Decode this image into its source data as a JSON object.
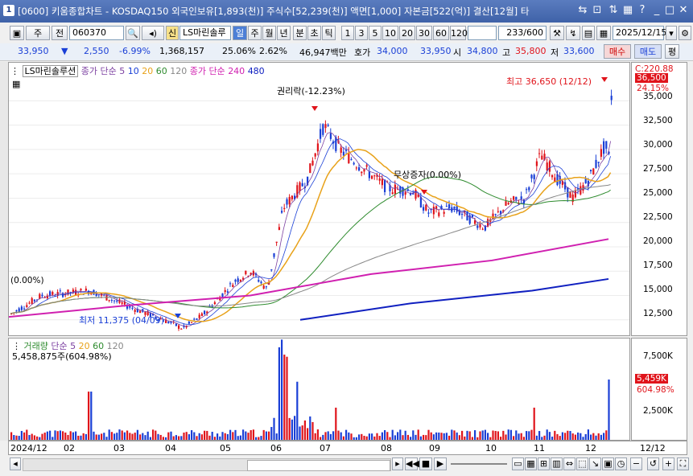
{
  "window": {
    "number": "1",
    "title": "[0600] 키움종합차트 - KOSDAQ150 외국인보유[1,893(천)] 주식수[52,239(천)] 액면[1,000] 자본금[522(억)] 결산[12월] 타"
  },
  "toolbar": {
    "menu1": "주",
    "menu2": "전",
    "code": "060370",
    "badge_new": "신",
    "stock_name": "LS마린솔루",
    "periods": [
      "일",
      "주",
      "월",
      "년",
      "분",
      "초",
      "틱"
    ],
    "active_period": "일",
    "ticks": [
      "1",
      "3",
      "5",
      "10",
      "20",
      "30",
      "60",
      "120"
    ],
    "count": "233",
    "count_total": "/600",
    "date": "2025/12/15"
  },
  "quote": {
    "price": "33,950",
    "change": "2,550",
    "change_pct": "-6.99%",
    "volume": "1,368,157",
    "turnover_pct": "25.06%",
    "ratio": "2.62%",
    "amount": "46,947백만",
    "bid_label": "호가",
    "bid": "34,000",
    "ask": "33,950",
    "open_label": "시",
    "open": "34,800",
    "high_label": "고",
    "high": "35,800",
    "low_label": "저",
    "low": "33,600",
    "buy": "매수",
    "sell": "매도",
    "eval": "평"
  },
  "legend": {
    "name": "LS마린솔루션",
    "ma_label": "종가 단순",
    "ma_vals": [
      "5",
      "10",
      "20",
      "60",
      "120"
    ],
    "ma2_label": "종가 단순",
    "ma2_vals": [
      "240",
      "480"
    ]
  },
  "annotations": {
    "high": "최고 36,650 (12/12)",
    "low": "최저 11,375 (04/09)",
    "rights": "권리락(-12.23%)",
    "capital": "무상증자(0.00%)",
    "left_label": "(0.00%)"
  },
  "volume_legend": {
    "label": "거래량",
    "ma_label": "단순",
    "ma_vals": [
      "5",
      "20",
      "60",
      "120"
    ],
    "value": "5,458,875주(604.98%)"
  },
  "price_axis": {
    "top": "C:220.88",
    "ticks": [
      "35,000",
      "32,500",
      "30,000",
      "27,500",
      "25,000",
      "22,500",
      "20,000",
      "17,500",
      "15,000",
      "12,500"
    ],
    "tag_price": "36,500",
    "tag_pct": "24.15%"
  },
  "volume_axis": {
    "ticks": [
      "7,500K",
      "5,000K",
      "2,500K"
    ],
    "tag_vol": "5,459K",
    "tag_pct": "604.98%"
  },
  "time_axis": {
    "labels": [
      "2024/12",
      "02",
      "03",
      "04",
      "05",
      "06",
      "07",
      "08",
      "09",
      "10",
      "11",
      "12"
    ],
    "right": "12/12"
  },
  "colors": {
    "up": "#e0141b",
    "down": "#1a3fd6",
    "ma5": "#7b3fa0",
    "ma10": "#1a3fd6",
    "ma20": "#e8a21a",
    "ma60": "#2e8b2e",
    "ma120": "#888888",
    "ma240": "#d020b0",
    "ma480": "#1020c0"
  }
}
